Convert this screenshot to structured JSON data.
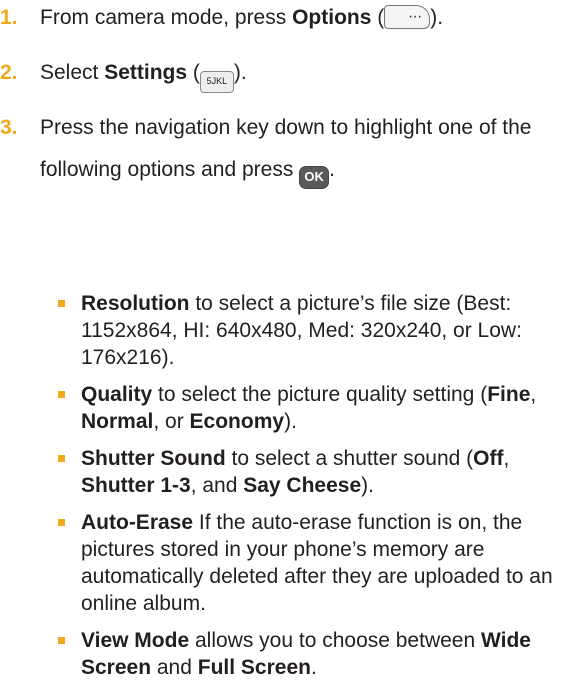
{
  "steps": [
    {
      "num": "1.",
      "pre": "From camera mode, press ",
      "bold": "Options",
      "post_open": " (",
      "post_close": ")."
    },
    {
      "num": "2.",
      "pre": "Select ",
      "bold": "Settings",
      "post_open": " (",
      "key": "5JKL",
      "post_close": ")."
    },
    {
      "num": "3.",
      "line1": "Press the navigation key down to highlight one of the",
      "line2": "following options and press ",
      "key": "OK",
      "end": "."
    }
  ],
  "options": [
    {
      "title": "Resolution",
      "text": " to select a picture’s file size (Best: 1152x864, HI: 640x480, Med: 320x240, or Low: 176x216)."
    },
    {
      "title": "Quality",
      "text1": " to select the picture quality setting (",
      "b1": "Fine",
      "t2": ", ",
      "b2": "Normal",
      "t3": ", or ",
      "b3": "Economy",
      "t4": ")."
    },
    {
      "title": "Shutter Sound",
      "text1": " to select a shutter sound (",
      "b1": "Off",
      "t2": ", ",
      "b2": "Shutter 1-3",
      "t3": ", and ",
      "b3": "Say Cheese",
      "t4": ")."
    },
    {
      "title": "Auto-Erase",
      "text": " If the auto-erase function is on, the pictures stored in your phone’s memory are automatically deleted after they are uploaded to an online album."
    },
    {
      "title": "View Mode",
      "text1": " allows you to choose between ",
      "b1": "Wide Screen",
      "t2": " and ",
      "b2": "Full Screen",
      "t3": "."
    }
  ],
  "colors": {
    "accent": "#f2a81d",
    "text": "#231f20"
  }
}
